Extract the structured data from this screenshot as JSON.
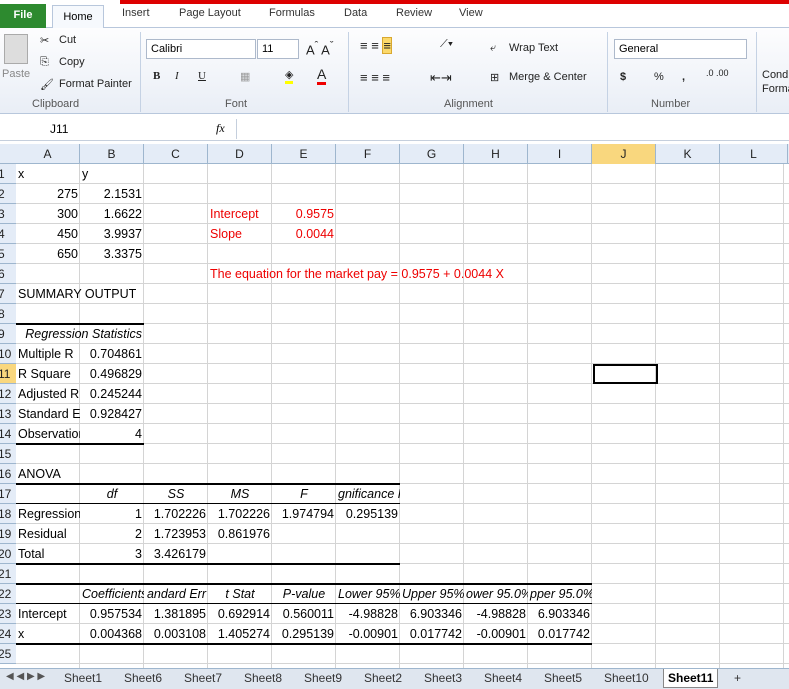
{
  "ribbon": {
    "tabs": [
      "File",
      "Home",
      "Insert",
      "Page Layout",
      "Formulas",
      "Data",
      "Review",
      "View"
    ],
    "clipboard": {
      "paste": "Paste",
      "cut": "Cut",
      "copy": "Copy",
      "format_painter": "Format Painter",
      "group": "Clipboard"
    },
    "font": {
      "name": "Calibri",
      "size": "11",
      "group": "Font",
      "bold": "B",
      "italic": "I",
      "underline": "U"
    },
    "alignment": {
      "wrap": "Wrap Text",
      "merge": "Merge & Center",
      "group": "Alignment"
    },
    "number": {
      "format": "General",
      "group": "Number",
      "currency": "$",
      "percent": "%",
      "comma": ","
    },
    "styles": {
      "cond": "Cond Forma"
    }
  },
  "formula_bar": {
    "name_box": "J11",
    "fx": "fx",
    "value": ""
  },
  "columns": [
    "A",
    "B",
    "C",
    "D",
    "E",
    "F",
    "G",
    "H",
    "I",
    "J",
    "K",
    "L"
  ],
  "selected": {
    "col": "J",
    "row": 11
  },
  "cells": [
    {
      "r": 1,
      "c": 0,
      "v": "x"
    },
    {
      "r": 1,
      "c": 1,
      "v": "y"
    },
    {
      "r": 2,
      "c": 0,
      "v": "275",
      "n": 1
    },
    {
      "r": 2,
      "c": 1,
      "v": "2.1531",
      "n": 1
    },
    {
      "r": 3,
      "c": 0,
      "v": "300",
      "n": 1
    },
    {
      "r": 3,
      "c": 1,
      "v": "1.6622",
      "n": 1
    },
    {
      "r": 3,
      "c": 3,
      "v": "Intercept",
      "red": 1
    },
    {
      "r": 3,
      "c": 4,
      "v": "0.9575",
      "n": 1,
      "red": 1
    },
    {
      "r": 4,
      "c": 0,
      "v": "450",
      "n": 1
    },
    {
      "r": 4,
      "c": 1,
      "v": "3.9937",
      "n": 1
    },
    {
      "r": 4,
      "c": 3,
      "v": "Slope",
      "red": 1
    },
    {
      "r": 4,
      "c": 4,
      "v": "0.0044",
      "n": 1,
      "red": 1
    },
    {
      "r": 5,
      "c": 0,
      "v": "650",
      "n": 1
    },
    {
      "r": 5,
      "c": 1,
      "v": "3.3375",
      "n": 1
    },
    {
      "r": 6,
      "c": 3,
      "v": "The equation for the market pay = 0.9575 + 0.0044 X",
      "red": 1
    },
    {
      "r": 7,
      "c": 0,
      "v": "SUMMARY OUTPUT"
    },
    {
      "r": 9,
      "c": 0,
      "v": "Regression Statistics",
      "it": 1,
      "span": 2
    },
    {
      "r": 10,
      "c": 0,
      "v": "Multiple R",
      "clip": 1
    },
    {
      "r": 10,
      "c": 1,
      "v": "0.704861",
      "n": 1
    },
    {
      "r": 11,
      "c": 0,
      "v": "R Square"
    },
    {
      "r": 11,
      "c": 1,
      "v": "0.496829",
      "n": 1
    },
    {
      "r": 12,
      "c": 0,
      "v": "Adjusted R Square",
      "clip": 1
    },
    {
      "r": 12,
      "c": 1,
      "v": "0.245244",
      "n": 1
    },
    {
      "r": 13,
      "c": 0,
      "v": "Standard Error",
      "clip": 1
    },
    {
      "r": 13,
      "c": 1,
      "v": "0.928427",
      "n": 1
    },
    {
      "r": 14,
      "c": 0,
      "v": "Observations",
      "clip": 1
    },
    {
      "r": 14,
      "c": 1,
      "v": "4",
      "n": 1
    },
    {
      "r": 16,
      "c": 0,
      "v": "ANOVA"
    },
    {
      "r": 17,
      "c": 1,
      "v": "df",
      "it": 1
    },
    {
      "r": 17,
      "c": 2,
      "v": "SS",
      "it": 1
    },
    {
      "r": 17,
      "c": 3,
      "v": "MS",
      "it": 1
    },
    {
      "r": 17,
      "c": 4,
      "v": "F",
      "it": 1
    },
    {
      "r": 17,
      "c": 5,
      "v": "gnificance F",
      "it": 1
    },
    {
      "r": 18,
      "c": 0,
      "v": "Regression",
      "clip": 1
    },
    {
      "r": 18,
      "c": 1,
      "v": "1",
      "n": 1
    },
    {
      "r": 18,
      "c": 2,
      "v": "1.702226",
      "n": 1
    },
    {
      "r": 18,
      "c": 3,
      "v": "1.702226",
      "n": 1
    },
    {
      "r": 18,
      "c": 4,
      "v": "1.974794",
      "n": 1
    },
    {
      "r": 18,
      "c": 5,
      "v": "0.295139",
      "n": 1
    },
    {
      "r": 19,
      "c": 0,
      "v": "Residual"
    },
    {
      "r": 19,
      "c": 1,
      "v": "2",
      "n": 1
    },
    {
      "r": 19,
      "c": 2,
      "v": "1.723953",
      "n": 1
    },
    {
      "r": 19,
      "c": 3,
      "v": "0.861976",
      "n": 1
    },
    {
      "r": 20,
      "c": 0,
      "v": "Total"
    },
    {
      "r": 20,
      "c": 1,
      "v": "3",
      "n": 1
    },
    {
      "r": 20,
      "c": 2,
      "v": "3.426179",
      "n": 1
    },
    {
      "r": 22,
      "c": 1,
      "v": "Coefficients",
      "it": 1
    },
    {
      "r": 22,
      "c": 2,
      "v": "andard Err",
      "it": 1
    },
    {
      "r": 22,
      "c": 3,
      "v": "t Stat",
      "it": 1
    },
    {
      "r": 22,
      "c": 4,
      "v": "P-value",
      "it": 1
    },
    {
      "r": 22,
      "c": 5,
      "v": "Lower 95%",
      "it": 1
    },
    {
      "r": 22,
      "c": 6,
      "v": "Upper 95%",
      "it": 1
    },
    {
      "r": 22,
      "c": 7,
      "v": "ower 95.0%",
      "it": 1
    },
    {
      "r": 22,
      "c": 8,
      "v": "pper 95.0%",
      "it": 1
    },
    {
      "r": 23,
      "c": 0,
      "v": "Intercept"
    },
    {
      "r": 23,
      "c": 1,
      "v": "0.957534",
      "n": 1
    },
    {
      "r": 23,
      "c": 2,
      "v": "1.381895",
      "n": 1
    },
    {
      "r": 23,
      "c": 3,
      "v": "0.692914",
      "n": 1
    },
    {
      "r": 23,
      "c": 4,
      "v": "0.560011",
      "n": 1
    },
    {
      "r": 23,
      "c": 5,
      "v": "-4.98828",
      "n": 1
    },
    {
      "r": 23,
      "c": 6,
      "v": "6.903346",
      "n": 1
    },
    {
      "r": 23,
      "c": 7,
      "v": "-4.98828",
      "n": 1
    },
    {
      "r": 23,
      "c": 8,
      "v": "6.903346",
      "n": 1
    },
    {
      "r": 24,
      "c": 0,
      "v": "x"
    },
    {
      "r": 24,
      "c": 1,
      "v": "0.004368",
      "n": 1
    },
    {
      "r": 24,
      "c": 2,
      "v": "0.003108",
      "n": 1
    },
    {
      "r": 24,
      "c": 3,
      "v": "1.405274",
      "n": 1
    },
    {
      "r": 24,
      "c": 4,
      "v": "0.295139",
      "n": 1
    },
    {
      "r": 24,
      "c": 5,
      "v": "-0.00901",
      "n": 1
    },
    {
      "r": 24,
      "c": 6,
      "v": "0.017742",
      "n": 1
    },
    {
      "r": 24,
      "c": 7,
      "v": "-0.00901",
      "n": 1
    },
    {
      "r": 24,
      "c": 8,
      "v": "0.017742",
      "n": 1
    }
  ],
  "sheets": [
    "Sheet1",
    "Sheet6",
    "Sheet7",
    "Sheet8",
    "Sheet9",
    "Sheet2",
    "Sheet3",
    "Sheet4",
    "Sheet5",
    "Sheet10",
    "Sheet11"
  ],
  "active_sheet": "Sheet11"
}
